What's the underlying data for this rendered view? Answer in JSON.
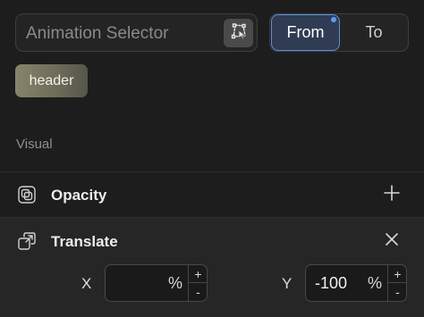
{
  "selector": {
    "placeholder": "Animation Selector",
    "button_icon": "selector-target-icon"
  },
  "toggle": {
    "from_label": "From",
    "to_label": "To",
    "active": "From",
    "accent": "#5d8ede"
  },
  "chip": {
    "label": "header"
  },
  "section": {
    "label": "Visual"
  },
  "opacity": {
    "label": "Opacity",
    "icon": "opacity-icon",
    "action_icon": "plus-icon"
  },
  "translate": {
    "label": "Translate",
    "icon": "translate-icon",
    "action_icon": "close-icon",
    "x": {
      "label": "X",
      "value": "",
      "unit": "%",
      "inc": "+",
      "dec": "-"
    },
    "y": {
      "label": "Y",
      "value": "-100",
      "unit": "%",
      "inc": "+",
      "dec": "-"
    }
  }
}
